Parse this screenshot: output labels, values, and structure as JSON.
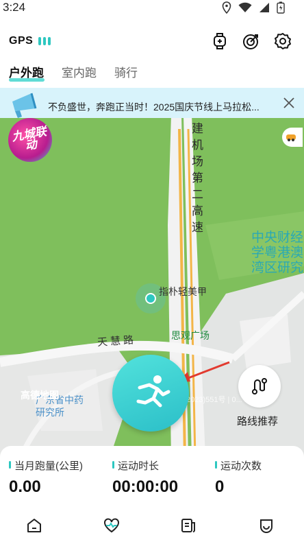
{
  "status_bar": {
    "time": "3:24"
  },
  "header": {
    "gps_label": "GPS"
  },
  "tabs": [
    {
      "label": "户外跑",
      "active": true
    },
    {
      "label": "室内跑",
      "active": false
    },
    {
      "label": "骑行",
      "active": false
    }
  ],
  "banner": {
    "text": "不负盛世，奔跑正当时！2025国庆节线上马拉松..."
  },
  "promo": {
    "logo_text": "九城联动"
  },
  "map": {
    "road_name": "建机场第二高速",
    "poi_zhipu": "指朴轻美甲",
    "road_tianhui": "天慧路",
    "poi_siguan": "思观广场",
    "poi_cuhk": "中央财经学粤港澳湾区研究",
    "poi_medicine": "广东省中药研究所",
    "map_brand": "高德地图",
    "copyright": "2023)551号 | 0... 2175号"
  },
  "route": {
    "label": "路线推荐"
  },
  "stats": [
    {
      "label": "当月跑量(公里)",
      "value": "0.00"
    },
    {
      "label": "运动时长",
      "value": "00:00:00"
    },
    {
      "label": "运动次数",
      "value": "0"
    }
  ],
  "bottom_nav": [
    {
      "label": "首页",
      "active": false
    },
    {
      "label": "运动",
      "active": true
    },
    {
      "label": "赛事",
      "active": false
    },
    {
      "label": "我的",
      "active": false
    }
  ],
  "colors": {
    "accent": "#2ec7c0",
    "map_green": "#7fbf5c",
    "banner_bg": "#d8f3fb"
  }
}
